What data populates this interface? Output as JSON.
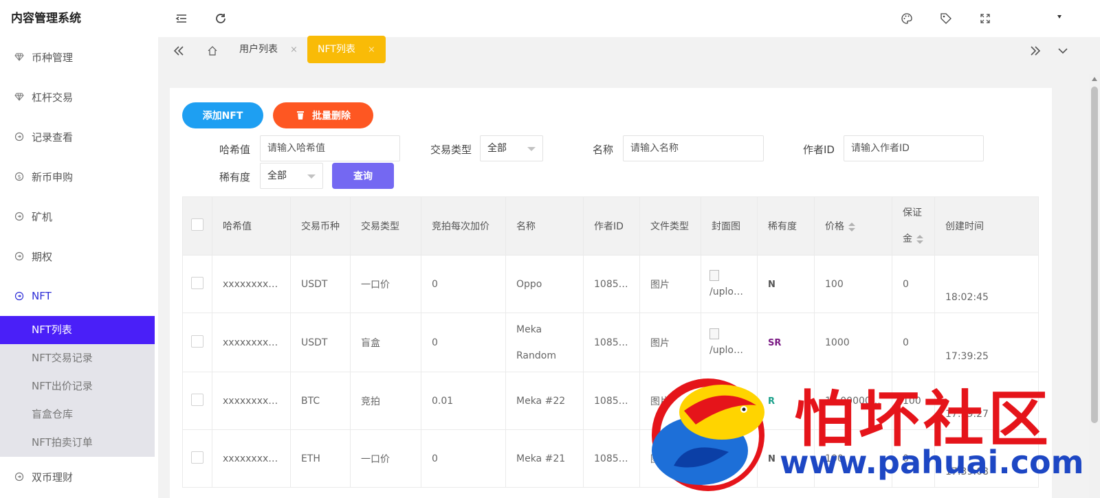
{
  "app": {
    "title": "内容管理系统"
  },
  "sidebar": {
    "items": [
      {
        "label": "币种管理",
        "icon": "diamond-icon"
      },
      {
        "label": "杠杆交易",
        "icon": "diamond-icon"
      },
      {
        "label": "记录查看",
        "icon": "circle-arrow-icon"
      },
      {
        "label": "新币申购",
        "icon": "dollar-circle-icon"
      },
      {
        "label": "矿机",
        "icon": "circle-arrow-icon"
      },
      {
        "label": "期权",
        "icon": "circle-arrow-icon"
      },
      {
        "label": "NFT",
        "icon": "circle-arrow-icon"
      }
    ],
    "nft_submenu": [
      "NFT列表",
      "NFT交易记录",
      "NFT出价记录",
      "盲盒仓库",
      "NFT拍卖订单"
    ],
    "after": {
      "label": "双币理财",
      "icon": "circle-arrow-icon"
    }
  },
  "header": {
    "icons": [
      "menu-fold-icon",
      "refresh-icon",
      "theme-icon",
      "tag-icon",
      "fullscreen-icon"
    ]
  },
  "tabs": [
    {
      "label": "用户列表",
      "close": "×"
    },
    {
      "label": "NFT列表",
      "close": "×"
    }
  ],
  "toolbar": {
    "add_label": "添加NFT",
    "batch_delete_label": "批量删除"
  },
  "filters": {
    "hash_label": "哈希值",
    "hash_placeholder": "请输入哈希值",
    "trade_type_label": "交易类型",
    "trade_type_value": "全部",
    "name_label": "名称",
    "name_placeholder": "请输入名称",
    "author_label": "作者ID",
    "author_placeholder": "请输入作者ID",
    "rarity_label": "稀有度",
    "rarity_value": "全部",
    "query_label": "查询"
  },
  "table": {
    "headers": [
      "哈希值",
      "交易币种",
      "交易类型",
      "竞拍每次加价",
      "名称",
      "作者ID",
      "文件类型",
      "封面图",
      "稀有度",
      "价格",
      "保证金",
      "创建时间"
    ],
    "rows": [
      {
        "hash": "xxxxxxxxxxxxxxxx",
        "coin": "USDT",
        "type": "一口价",
        "increment": "0",
        "name": "Oppo",
        "author": "10856...",
        "file": "图片",
        "cover": "/upload_nft",
        "rarity": "N",
        "rarity_color": "#555555",
        "price": "100",
        "deposit": "0",
        "time": "18:02:45"
      },
      {
        "hash": "xxxxxxxxxxxxxxxx",
        "coin": "USDT",
        "type": "盲盒",
        "increment": "0",
        "name": "Meka Random",
        "author": "10856...",
        "file": "图片",
        "cover": "/upload_nft",
        "rarity": "SR",
        "rarity_color": "#7a1a84",
        "price": "1000",
        "deposit": "0",
        "time": "17:39:25"
      },
      {
        "hash": "xxxxxxxxxxxxxxxx",
        "coin": "BTC",
        "type": "竞拍",
        "increment": "0.01",
        "name": "Meka #22",
        "author": "10856...",
        "file": "图片",
        "cover": "/upload_nft",
        "rarity": "R",
        "rarity_color": "#1aa08a",
        "price": "10.0000000",
        "deposit": "100",
        "time": "17:39:27"
      },
      {
        "hash": "xxxxxxxxxxxxxxxx",
        "coin": "ETH",
        "type": "一口价",
        "increment": "0",
        "name": "Meka #21",
        "author": "10856...",
        "file": "图片",
        "cover": "/upload_nft",
        "rarity": "N",
        "rarity_color": "#555555",
        "price": "100",
        "deposit": "0",
        "time": "17:39:08"
      }
    ]
  },
  "watermark": {
    "text": "怕坏社区",
    "url": "www.pahuai.com"
  },
  "colors": {
    "accent_purple": "#4a1ff8",
    "tab_active": "#f9bb07",
    "add_blue": "#1e9ff2",
    "delete_orange": "#fe5722",
    "query_purple": "#7468f2"
  }
}
